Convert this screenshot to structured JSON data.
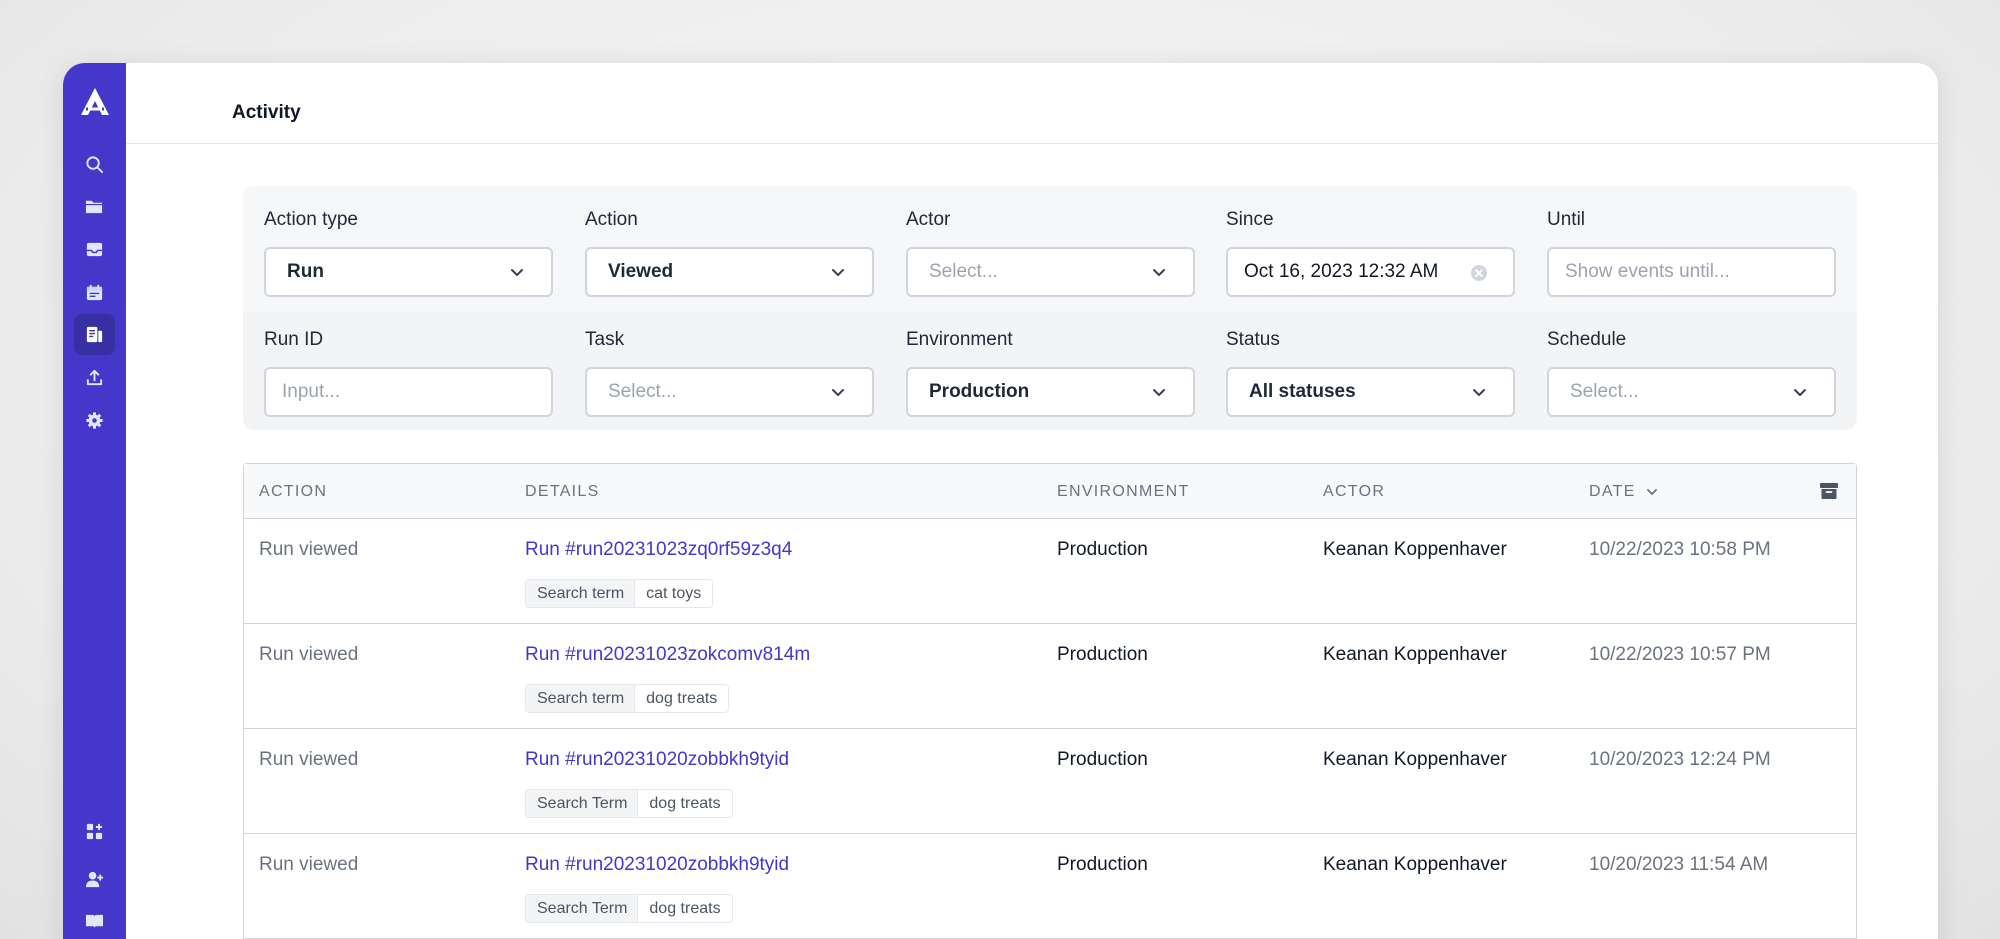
{
  "page": {
    "title": "Activity"
  },
  "sidebar": {
    "items": [
      {
        "icon": "search-icon",
        "label": "Search"
      },
      {
        "icon": "folder-icon",
        "label": "Projects"
      },
      {
        "icon": "inbox-icon",
        "label": "Inbox"
      },
      {
        "icon": "calendar-icon",
        "label": "Schedules"
      },
      {
        "icon": "activity-log-icon",
        "label": "Activity",
        "active": true
      },
      {
        "icon": "upload-icon",
        "label": "Deploy"
      },
      {
        "icon": "gear-icon",
        "label": "Settings"
      }
    ],
    "bottom_items": [
      {
        "icon": "add-app-icon",
        "label": "Integrations"
      },
      {
        "icon": "invite-user-icon",
        "label": "Invite"
      },
      {
        "icon": "book-icon",
        "label": "Docs"
      }
    ],
    "accent_color": "#4338ca"
  },
  "filters": {
    "action_type": {
      "label": "Action type",
      "value": "Run"
    },
    "action": {
      "label": "Action",
      "value": "Viewed"
    },
    "actor": {
      "label": "Actor",
      "placeholder": "Select..."
    },
    "since": {
      "label": "Since",
      "value": "Oct 16, 2023 12:32 AM"
    },
    "until": {
      "label": "Until",
      "placeholder": "Show events until..."
    },
    "run_id": {
      "label": "Run ID",
      "placeholder": "Input..."
    },
    "task": {
      "label": "Task",
      "placeholder": "Select..."
    },
    "environment": {
      "label": "Environment",
      "value": "Production"
    },
    "status": {
      "label": "Status",
      "value": "All statuses"
    },
    "schedule": {
      "label": "Schedule",
      "placeholder": "Select..."
    }
  },
  "table": {
    "columns": [
      "ACTION",
      "DETAILS",
      "ENVIRONMENT",
      "ACTOR",
      "DATE"
    ],
    "sort_column": "DATE",
    "rows": [
      {
        "action": "Run viewed",
        "run": "Run #run20231023zq0rf59z3q4",
        "key": "Search term",
        "value": "cat toys",
        "environment": "Production",
        "actor": "Keanan Koppenhaver",
        "date": "10/22/2023 10:58 PM"
      },
      {
        "action": "Run viewed",
        "run": "Run #run20231023zokcomv814m",
        "key": "Search term",
        "value": "dog treats",
        "environment": "Production",
        "actor": "Keanan Koppenhaver",
        "date": "10/22/2023 10:57 PM"
      },
      {
        "action": "Run viewed",
        "run": "Run #run20231020zobbkh9tyid",
        "key": "Search Term",
        "value": "dog treats",
        "environment": "Production",
        "actor": "Keanan Koppenhaver",
        "date": "10/20/2023 12:24 PM"
      },
      {
        "action": "Run viewed",
        "run": "Run #run20231020zobbkh9tyid",
        "key": "Search Term",
        "value": "dog treats",
        "environment": "Production",
        "actor": "Keanan Koppenhaver",
        "date": "10/20/2023 11:54 AM"
      }
    ]
  }
}
